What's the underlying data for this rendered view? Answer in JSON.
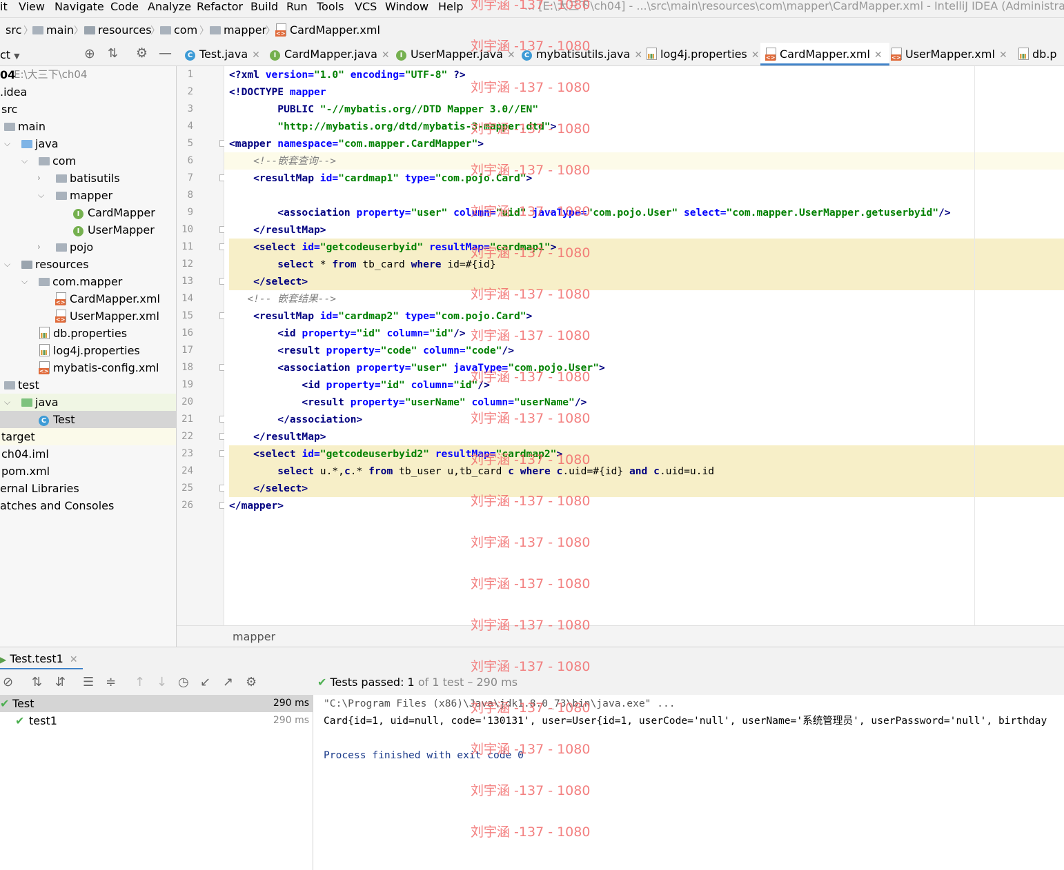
{
  "menu": {
    "items": [
      "it",
      "View",
      "Navigate",
      "Code",
      "Analyze",
      "Refactor",
      "Build",
      "Run",
      "Tools",
      "VCS",
      "Window",
      "Help"
    ],
    "window_title": "... [E:\\大三下\\ch04] - ...\\src\\main\\resources\\com\\mapper\\CardMapper.xml - IntelliJ IDEA (Administrator)"
  },
  "breadcrumb": [
    "src",
    "main",
    "resources",
    "com",
    "mapper",
    "CardMapper.xml"
  ],
  "project_panel": {
    "title": "ct",
    "tree": [
      {
        "label": "04",
        "extra": "E:\\大三下\\ch04",
        "indent": 0
      },
      {
        "label": ".idea",
        "indent": 0
      },
      {
        "label": "src",
        "indent": 0
      },
      {
        "label": "main",
        "indent": 1
      },
      {
        "label": "java",
        "indent": 2
      },
      {
        "label": "com",
        "indent": 3
      },
      {
        "label": "batisutils",
        "indent": 4
      },
      {
        "label": "mapper",
        "indent": 4
      },
      {
        "label": "CardMapper",
        "indent": 5
      },
      {
        "label": "UserMapper",
        "indent": 5
      },
      {
        "label": "pojo",
        "indent": 4
      },
      {
        "label": "resources",
        "indent": 2
      },
      {
        "label": "com.mapper",
        "indent": 3
      },
      {
        "label": "CardMapper.xml",
        "indent": 4
      },
      {
        "label": "UserMapper.xml",
        "indent": 4
      },
      {
        "label": "db.properties",
        "indent": 3
      },
      {
        "label": "log4j.properties",
        "indent": 3
      },
      {
        "label": "mybatis-config.xml",
        "indent": 3
      },
      {
        "label": "test",
        "indent": 1
      },
      {
        "label": "java",
        "indent": 2
      },
      {
        "label": "Test",
        "indent": 3
      },
      {
        "label": "target",
        "indent": 0
      },
      {
        "label": "ch04.iml",
        "indent": 0
      },
      {
        "label": "pom.xml",
        "indent": 0
      },
      {
        "label": "ernal Libraries",
        "indent": 0
      },
      {
        "label": "atches and Consoles",
        "indent": 0
      }
    ]
  },
  "tabs": [
    "Test.java",
    "CardMapper.java",
    "UserMapper.java",
    "mybatisutils.java",
    "log4j.properties",
    "CardMapper.xml",
    "UserMapper.xml",
    "db.p"
  ],
  "editor": {
    "line_numbers": [
      "1",
      "2",
      "3",
      "4",
      "5",
      "6",
      "7",
      "8",
      "9",
      "10",
      "11",
      "12",
      "13",
      "14",
      "15",
      "16",
      "17",
      "18",
      "19",
      "20",
      "21",
      "22",
      "23",
      "24",
      "25",
      "26"
    ],
    "code": {
      "l1a": "<?xml ",
      "l1b": "version=",
      "l1c": "\"1.0\"",
      "l1d": " encoding=",
      "l1e": "\"UTF-8\"",
      "l1f": " ?>",
      "l2a": "<!DOCTYPE ",
      "l2b": "mapper",
      "l3a": "        PUBLIC ",
      "l3b": "\"-//mybatis.org//DTD Mapper 3.0//EN\"",
      "l4a": "        ",
      "l4b": "\"http://mybatis.org/dtd/mybatis-3-mapper.dtd\"",
      "l4c": ">",
      "l5a": "<mapper ",
      "l5b": "namespace=",
      "l5c": "\"com.mapper.CardMapper\"",
      "l5d": ">",
      "l6": "    <!--嵌套查询-->",
      "l7a": "    <resultMap ",
      "l7b": "id=",
      "l7c": "\"cardmap1\"",
      "l7d": " type=",
      "l7e": "\"com.pojo.Card\"",
      "l7f": ">",
      "l9a": "        <association ",
      "l9b": "property=",
      "l9c": "\"user\"",
      "l9d": " column=",
      "l9e": "\"uid\"",
      "l9f": " javaType=",
      "l9g": "\"com.pojo.User\"",
      "l9h": " select=",
      "l9i": "\"com.mapper.UserMapper.getuserbyid\"",
      "l9j": "/>",
      "l10": "    </resultMap>",
      "l11a": "    <select ",
      "l11b": "id=",
      "l11c": "\"getcodeuserbyid\"",
      "l11d": " resultMap=",
      "l11e": "\"cardmap1\"",
      "l11f": ">",
      "l12a": "        select",
      "l12b": " * ",
      "l12c": "from",
      "l12d": " tb_card ",
      "l12e": "where",
      "l12f": " id=#{id}",
      "l13": "    </select>",
      "l14": "   <!-- 嵌套结果-->",
      "l15a": "    <resultMap ",
      "l15b": "id=",
      "l15c": "\"cardmap2\"",
      "l15d": " type=",
      "l15e": "\"com.pojo.Card\"",
      "l15f": ">",
      "l16a": "        <id ",
      "l16b": "property=",
      "l16c": "\"id\"",
      "l16d": " column=",
      "l16e": "\"id\"",
      "l16f": "/>",
      "l17a": "        <result ",
      "l17b": "property=",
      "l17c": "\"code\"",
      "l17d": " column=",
      "l17e": "\"code\"",
      "l17f": "/>",
      "l18a": "        <association ",
      "l18b": "property=",
      "l18c": "\"user\"",
      "l18d": " javaType=",
      "l18e": "\"com.pojo.User\"",
      "l18f": ">",
      "l19a": "            <id ",
      "l19b": "property=",
      "l19c": "\"id\"",
      "l19d": " column=",
      "l19e": "\"id\"",
      "l19f": "/>",
      "l20a": "            <result ",
      "l20b": "property=",
      "l20c": "\"userName\"",
      "l20d": " column=",
      "l20e": "\"userName\"",
      "l20f": "/>",
      "l21": "        </association>",
      "l22": "    </resultMap>",
      "l23a": "    <select ",
      "l23b": "id=",
      "l23c": "\"getcodeuserbyid2\"",
      "l23d": " resultMap=",
      "l23e": "\"cardmap2\"",
      "l23f": ">",
      "l24a": "        select",
      "l24b": " u.*,",
      "l24c": "c",
      "l24d": ".* ",
      "l24e": "from",
      "l24f": " tb_user u,tb_card ",
      "l24g": "c",
      "l24h": " ",
      "l24i": "where",
      "l24j": " ",
      "l24k": "c",
      "l24l": ".uid=#{id} ",
      "l24m": "and",
      "l24n": " ",
      "l24o": "c",
      "l24p": ".uid=u.id",
      "l25": "    </select>",
      "l26": "</mapper>"
    },
    "status_breadcrumb": "mapper"
  },
  "run_panel": {
    "tab_label": "Test.test1",
    "tests_passed_label": "Tests passed:",
    "tests_passed_count": "1",
    "tests_passed_detail": "of 1 test – 290 ms",
    "tree": [
      {
        "label": "Test",
        "time": "290 ms"
      },
      {
        "label": "test1",
        "time": "290 ms"
      }
    ],
    "console": [
      "\"C:\\Program Files (x86)\\Java\\jdk1.8.0_73\\bin\\java.exe\" ...",
      "Card{id=1, uid=null, code='130131', user=User{id=1, userCode='null', userName='系统管理员', userPassword='null', birthday",
      "",
      "Process finished with exit code 0"
    ]
  },
  "watermark": "刘宇涵 -137 - 1080"
}
